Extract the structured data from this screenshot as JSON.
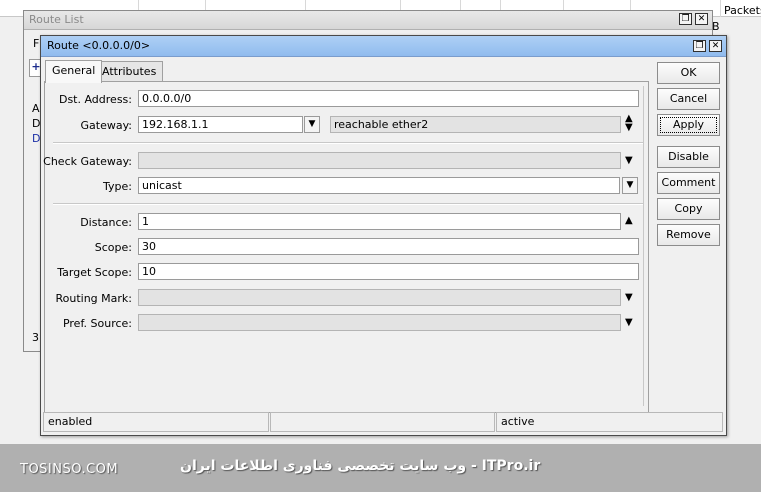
{
  "background": {
    "columns_header": "Packets",
    "fragment_b": "B",
    "route_list_title": "Route List",
    "fragments": [
      "F",
      "A",
      "D",
      "D",
      "3"
    ]
  },
  "window": {
    "title": "Route <0.0.0.0/0>",
    "tabs": [
      "General",
      "Attributes"
    ]
  },
  "form": {
    "dst_address": {
      "label": "Dst. Address:",
      "value": "0.0.0.0/0"
    },
    "gateway": {
      "label": "Gateway:",
      "value": "192.168.1.1",
      "status": "reachable ether2"
    },
    "check_gateway": {
      "label": "Check Gateway:",
      "value": ""
    },
    "type": {
      "label": "Type:",
      "value": "unicast"
    },
    "distance": {
      "label": "Distance:",
      "value": "1"
    },
    "scope": {
      "label": "Scope:",
      "value": "30"
    },
    "target_scope": {
      "label": "Target Scope:",
      "value": "10"
    },
    "routing_mark": {
      "label": "Routing Mark:",
      "value": ""
    },
    "pref_source": {
      "label": "Pref. Source:",
      "value": ""
    }
  },
  "buttons": {
    "ok": "OK",
    "cancel": "Cancel",
    "apply": "Apply",
    "disable": "Disable",
    "comment": "Comment",
    "copy": "Copy",
    "remove": "Remove"
  },
  "statusbar": {
    "left": "enabled",
    "middle": "",
    "right": "active"
  },
  "watermark": {
    "left": "TOSINSO.COM",
    "right": "ITPro.ir - وب سایت تخصصی فناوری اطلاعات ایران"
  },
  "icons": {
    "titlebar": [
      "restore-icon",
      "close-icon"
    ],
    "dropdown": "triangle-down-icon"
  }
}
